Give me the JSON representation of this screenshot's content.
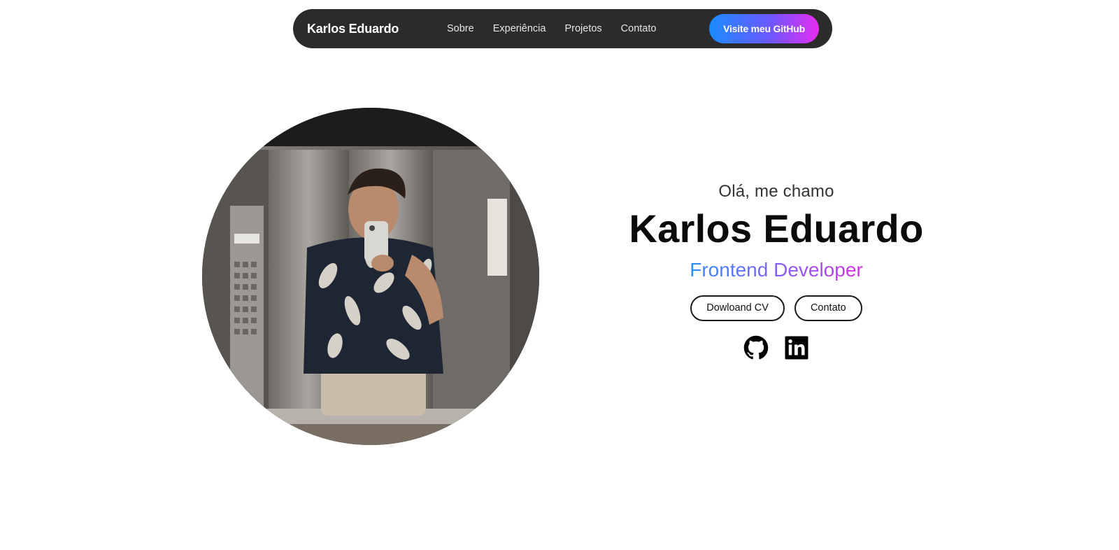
{
  "navbar": {
    "brand": "Karlos Eduardo",
    "links": [
      "Sobre",
      "Experiência",
      "Projetos",
      "Contato"
    ],
    "github_label": "Visite meu GitHub"
  },
  "hero": {
    "greeting": "Olá, me chamo",
    "name": "Karlos Eduardo",
    "role": "Frontend Developer",
    "buttons": {
      "cv": "Dowloand CV",
      "contact": "Contato"
    },
    "socials": [
      "github-icon",
      "linkedin-icon"
    ],
    "photo": "profile-photo"
  },
  "colors": {
    "nav_bg": "#2b2b2b",
    "gradient_start": "#1b8cff",
    "gradient_end": "#e62cf0",
    "text": "#0b0b0b"
  }
}
